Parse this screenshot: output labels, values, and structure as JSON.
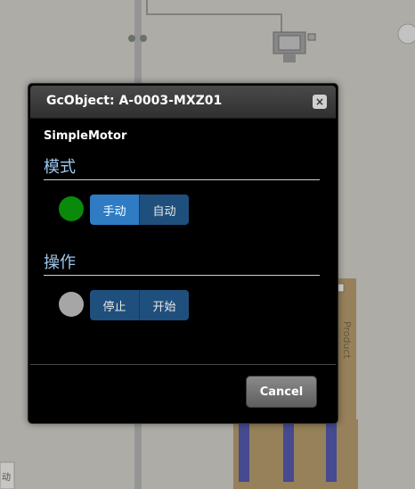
{
  "dialog": {
    "title": "GcObject: A-0003-MXZ01",
    "close_label": "×",
    "component_name": "SimpleMotor",
    "sections": [
      {
        "title": "模式",
        "indicator_color": "#0a8a0a",
        "buttons": [
          {
            "label": "手动",
            "active": true
          },
          {
            "label": "自动",
            "active": false
          }
        ]
      },
      {
        "title": "操作",
        "indicator_color": "#a6a6a6",
        "buttons": [
          {
            "label": "停止",
            "active": false
          },
          {
            "label": "开始",
            "active": false
          }
        ]
      }
    ],
    "cancel_label": "Cancel"
  },
  "background": {
    "product_label": "Product",
    "side_text": "动"
  }
}
